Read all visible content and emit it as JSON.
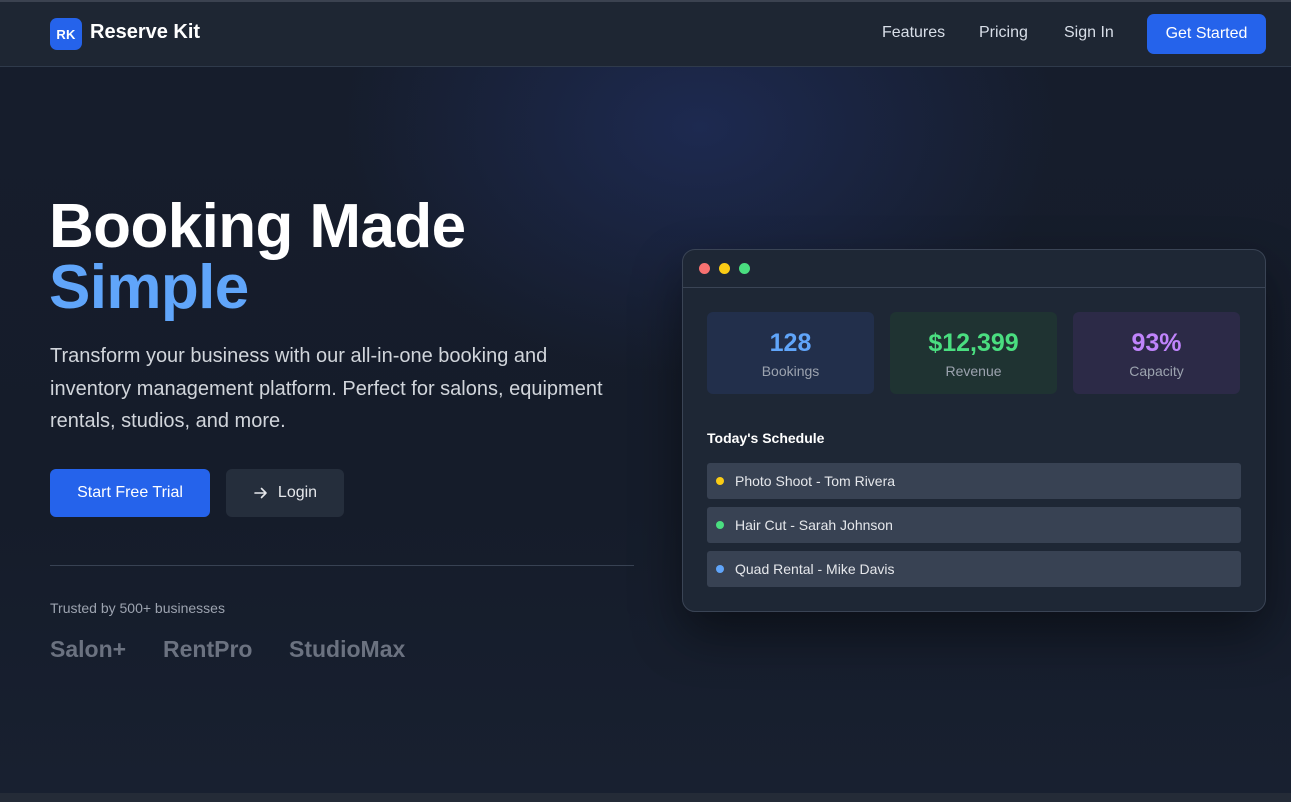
{
  "navbar": {
    "logo_initials": "RK",
    "brand": "Reserve Kit",
    "links": [
      "Features",
      "Pricing",
      "Sign In"
    ],
    "cta": "Get Started"
  },
  "hero": {
    "title_line1": "Booking Made",
    "title_line2": "Simple",
    "description": "Transform your business with our all-in-one booking and inventory management platform. Perfect for salons, equipment rentals, studios, and more.",
    "primary_button": "Start Free Trial",
    "secondary_button": "Login",
    "secondary_button_icon": "arrow-right-icon",
    "trusted_text": "Trusted by 500+ businesses",
    "clients": [
      "Salon+",
      "RentPro",
      "StudioMax"
    ]
  },
  "dashboard": {
    "window_controls": [
      "close",
      "minimize",
      "maximize"
    ],
    "stats": [
      {
        "value": "128",
        "label": "Bookings",
        "color": "#60a5fa"
      },
      {
        "value": "$12,399",
        "label": "Revenue",
        "color": "#4ade80"
      },
      {
        "value": "93%",
        "label": "Capacity",
        "color": "#c084fc"
      }
    ],
    "schedule_title": "Today's Schedule",
    "schedule": [
      {
        "text": "Photo Shoot - Tom Rivera",
        "status_color": "#facc15"
      },
      {
        "text": "Hair Cut - Sarah Johnson",
        "status_color": "#4ade80"
      },
      {
        "text": "Quad Rental - Mike Davis",
        "status_color": "#60a5fa"
      }
    ]
  },
  "colors": {
    "accent": "#2563eb",
    "highlight": "#60a5fa",
    "background": "#161e2d"
  }
}
